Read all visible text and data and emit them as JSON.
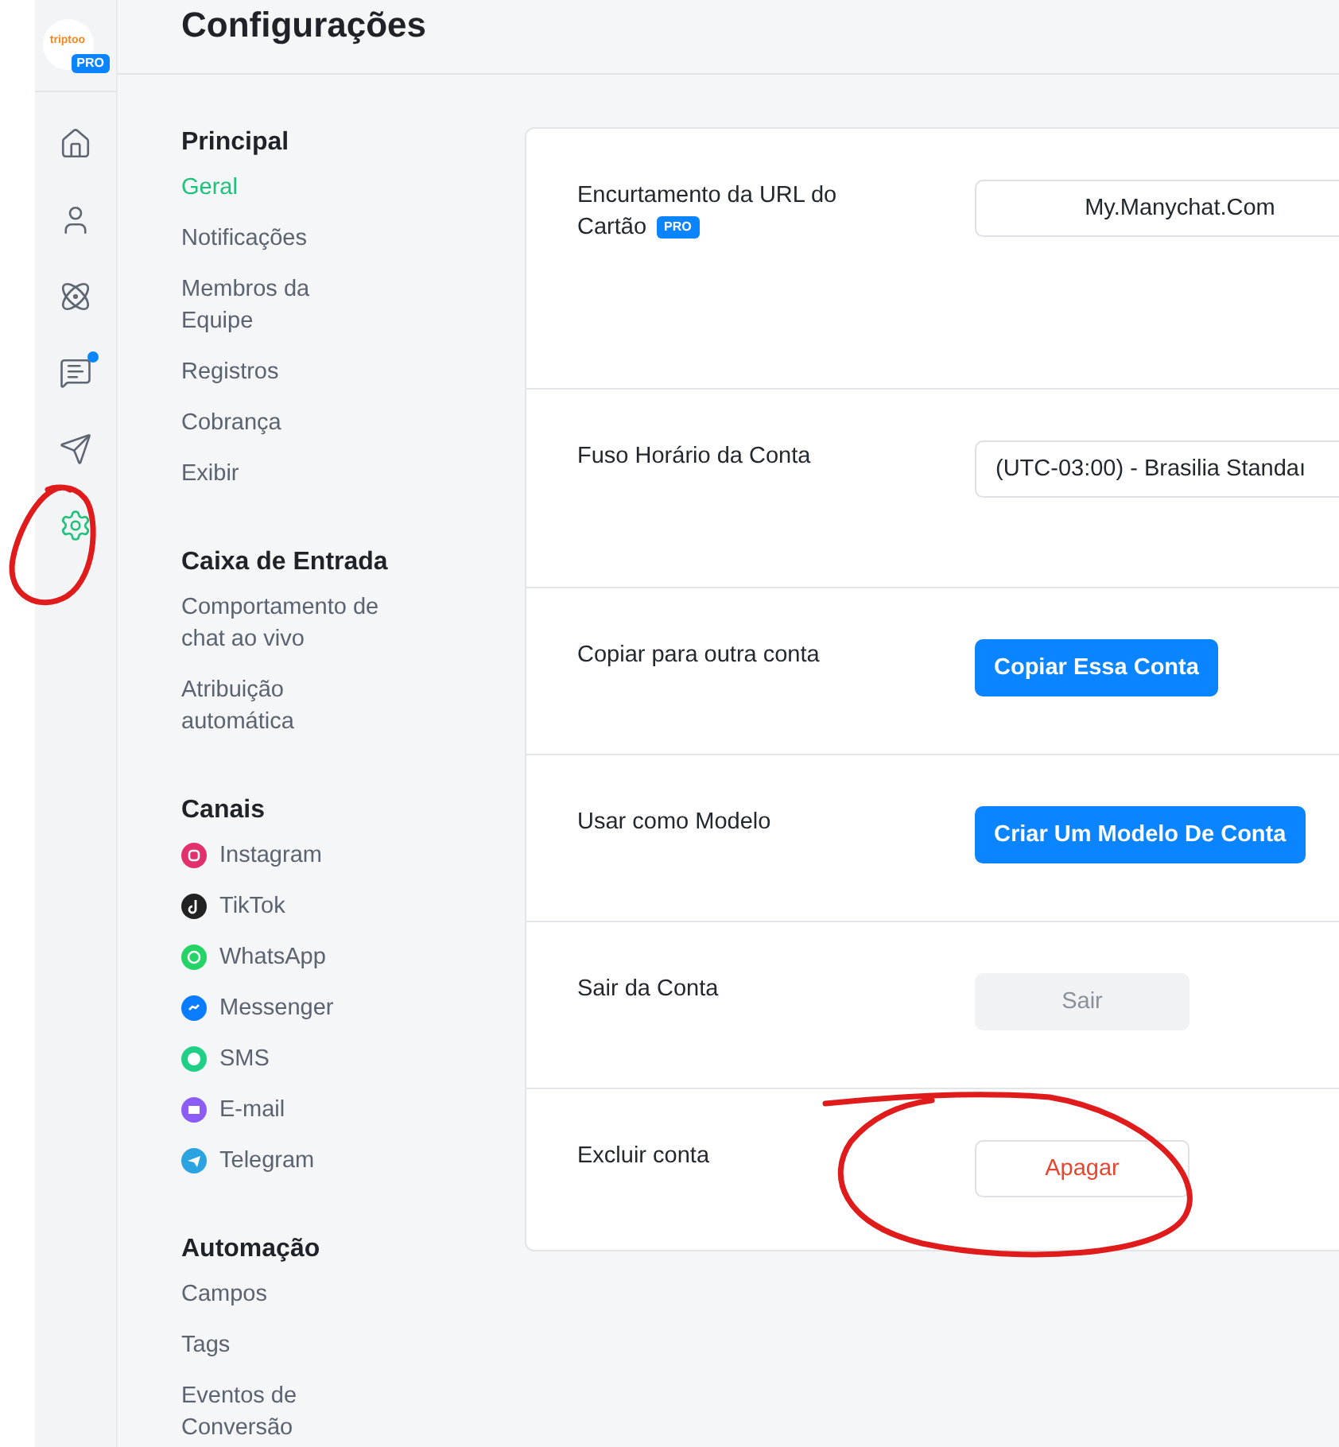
{
  "logo": {
    "text": "triptoo",
    "badge": "PRO"
  },
  "rail": [
    {
      "kind": "home",
      "selected": false
    },
    {
      "kind": "contacts",
      "selected": false
    },
    {
      "kind": "automation",
      "selected": false
    },
    {
      "kind": "chat",
      "selected": false,
      "badge": true
    },
    {
      "kind": "broadcast",
      "selected": false
    },
    {
      "kind": "settings",
      "selected": true
    }
  ],
  "title": "Configurações",
  "nav": [
    {
      "heading": "Principal",
      "items": [
        {
          "label": "Geral",
          "selected": true
        },
        {
          "label": "Notificações",
          "selected": false
        },
        {
          "label": "Membros da Equipe",
          "selected": false
        },
        {
          "label": "Registros",
          "selected": false
        },
        {
          "label": "Cobrança",
          "selected": false
        },
        {
          "label": "Exibir",
          "selected": false
        }
      ]
    },
    {
      "heading": "Caixa de Entrada",
      "items": [
        {
          "label": "Comportamento de chat ao vivo",
          "selected": false
        },
        {
          "label": "Atribuição automática",
          "selected": false
        }
      ]
    },
    {
      "heading": "Canais",
      "items": [
        {
          "label": "Instagram",
          "selected": false,
          "kind": "instagram",
          "color": "#e1306c"
        },
        {
          "label": "TikTok",
          "selected": false,
          "kind": "tiktok",
          "color": "#222222"
        },
        {
          "label": "WhatsApp",
          "selected": false,
          "kind": "whatsapp",
          "color": "#25d366"
        },
        {
          "label": "Messenger",
          "selected": false,
          "kind": "messenger",
          "color": "#0a7cff"
        },
        {
          "label": "SMS",
          "selected": false,
          "kind": "sms",
          "color": "#1fcf85"
        },
        {
          "label": "E-mail",
          "selected": false,
          "kind": "email",
          "color": "#8b5cf6"
        },
        {
          "label": "Telegram",
          "selected": false,
          "kind": "telegram",
          "color": "#2aa3e0"
        }
      ]
    },
    {
      "heading": "Automação",
      "items": [
        {
          "label": "Campos",
          "selected": false
        },
        {
          "label": "Tags",
          "selected": false
        },
        {
          "label": "Eventos de Conversão",
          "selected": false
        }
      ]
    }
  ],
  "settings": [
    {
      "label": "Encurtamento da URL do Cartão",
      "badge": "PRO",
      "kind": "input",
      "value": "My.Manychat.Com"
    },
    {
      "label": "Fuso Horário da Conta",
      "kind": "select",
      "value": "(UTC-03:00) - Brasilia Standaı"
    },
    {
      "label": "Copiar para outra conta",
      "kind": "primary",
      "value": "Copiar Essa Conta"
    },
    {
      "label": "Usar como Modelo",
      "kind": "primary",
      "value": "Criar Um Modelo De Conta"
    },
    {
      "label": "Sair da Conta",
      "kind": "secondary",
      "value": "Sair"
    },
    {
      "label": "Excluir conta",
      "kind": "danger",
      "value": "Apagar"
    }
  ]
}
